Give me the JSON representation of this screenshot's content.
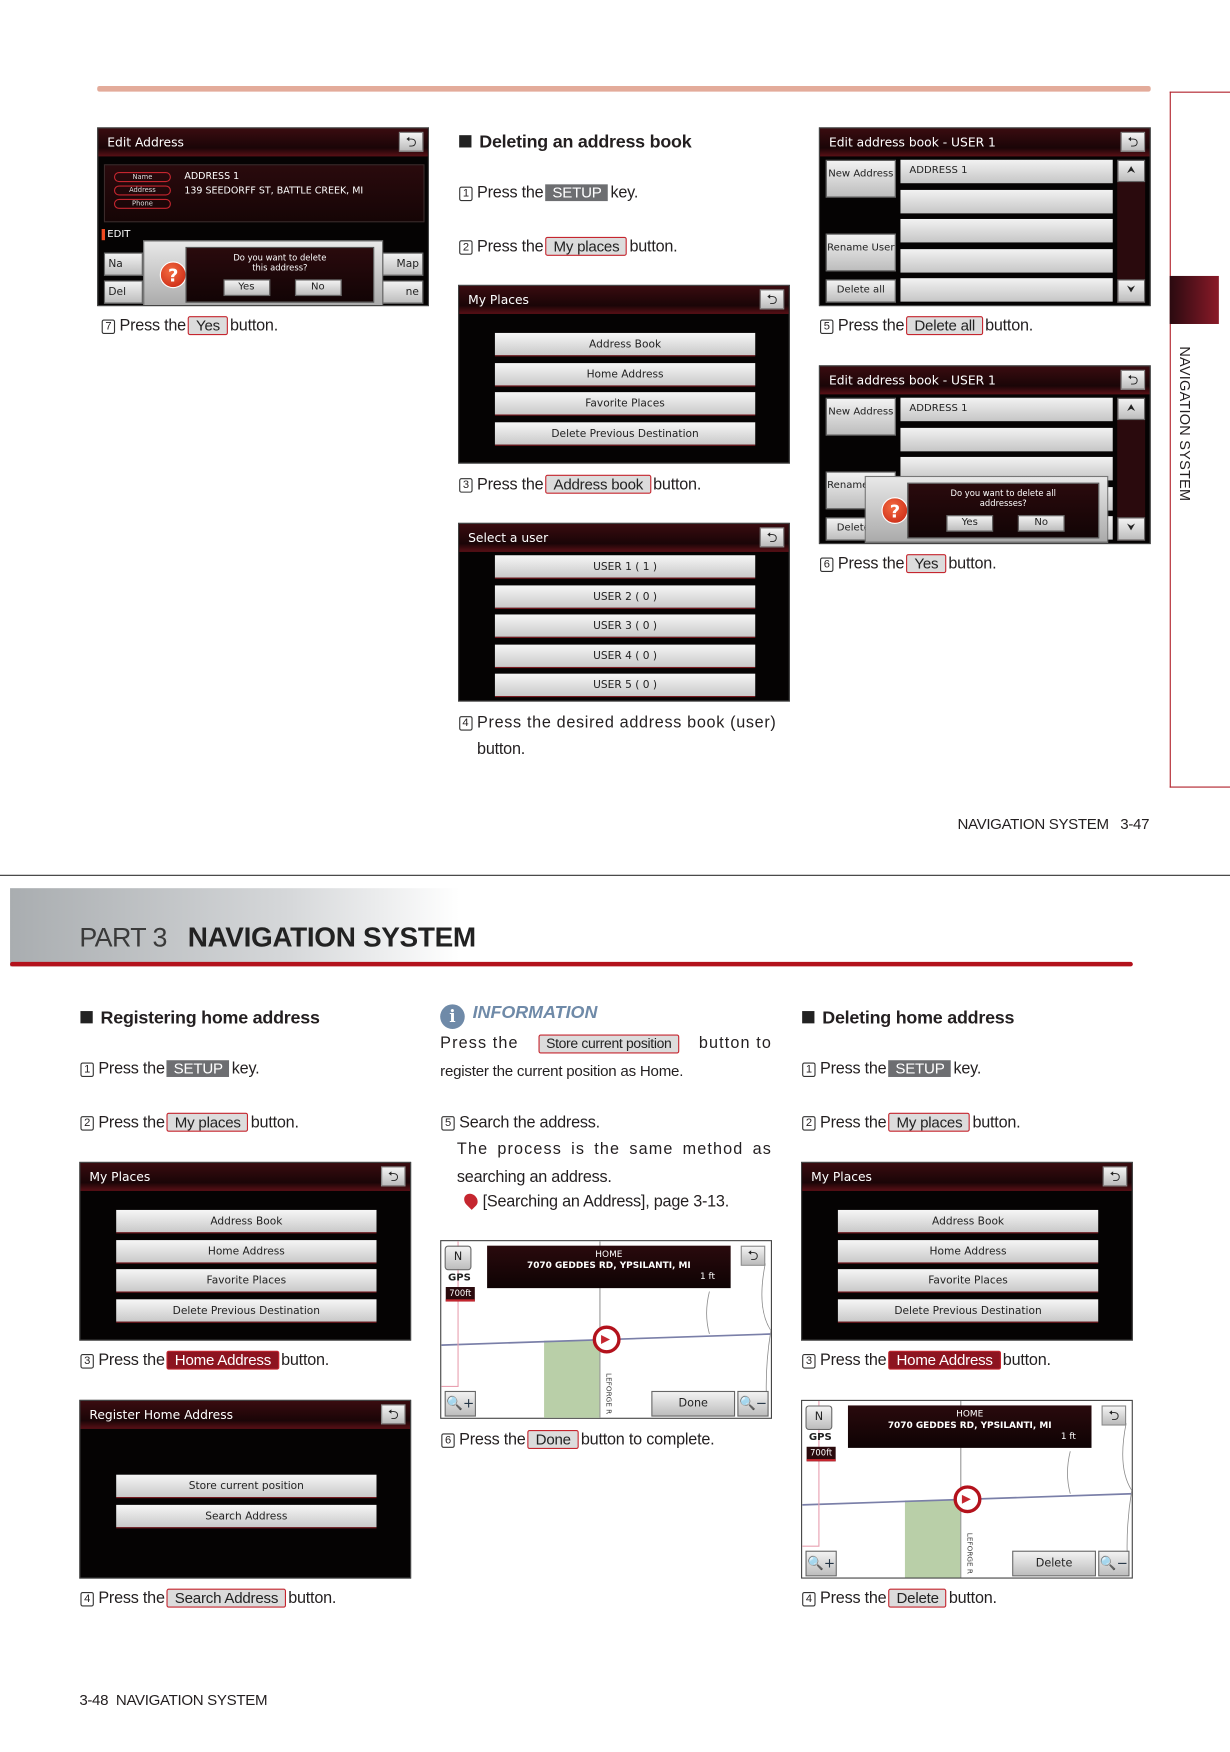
{
  "sidebar_label": "NAVIGATION SYSTEM",
  "top_page": {
    "footer": {
      "section": "NAVIGATION SYSTEM",
      "page": "3-47"
    },
    "col1": {
      "step7": {
        "num": "7",
        "pre": "Press the",
        "btn": "Yes",
        "post": "button."
      }
    },
    "col2": {
      "heading": "Deleting an address book",
      "step1": {
        "num": "1",
        "pre": "Press the",
        "btn": "SETUP",
        "post": "key."
      },
      "step2": {
        "num": "2",
        "pre": "Press the",
        "btn": "My places",
        "post": "button."
      },
      "step3": {
        "num": "3",
        "pre": "Press the",
        "btn": "Address book",
        "post": "button."
      },
      "step4": {
        "num": "4",
        "line1": "Press the desired address book (user)",
        "line2": "button."
      }
    },
    "col3": {
      "step5": {
        "num": "5",
        "pre": "Press the",
        "btn": "Delete all",
        "post": "button."
      },
      "step6": {
        "num": "6",
        "pre": "Press the",
        "btn": "Yes",
        "post": "button."
      }
    }
  },
  "bottom_page": {
    "banner": {
      "part": "PART 3",
      "title": "NAVIGATION SYSTEM"
    },
    "footer": {
      "page": "3-48",
      "section": "NAVIGATION SYSTEM"
    },
    "col1": {
      "heading": "Registering home address",
      "step1": {
        "num": "1",
        "pre": "Press the",
        "btn": "SETUP",
        "post": "key."
      },
      "step2": {
        "num": "2",
        "pre": "Press the",
        "btn": "My places",
        "post": "button."
      },
      "step3": {
        "num": "3",
        "pre": "Press the",
        "btn": "Home Address",
        "post": "button."
      },
      "step4": {
        "num": "4",
        "pre": "Press the",
        "btn": "Search Address",
        "post": "button."
      }
    },
    "col2": {
      "info_title": "INFORMATION",
      "info_pre": "Press the",
      "info_btn": "Store current position",
      "info_post": "button to",
      "info_line2": "register the current position as Home.",
      "step5": {
        "num": "5",
        "text": "Search the address.",
        "line2": "The process is the same method as",
        "line3": "searching an address.",
        "ref": "[Searching an Address], page 3-13."
      },
      "step6": {
        "num": "6",
        "pre": "Press the",
        "btn": "Done",
        "post": "button to complete."
      }
    },
    "col3": {
      "heading": "Deleting home address",
      "step1": {
        "num": "1",
        "pre": "Press the",
        "btn": "SETUP",
        "post": "key."
      },
      "step2": {
        "num": "2",
        "pre": "Press the",
        "btn": "My places",
        "post": "button."
      },
      "step3": {
        "num": "3",
        "pre": "Press the",
        "btn": "Home Address",
        "post": "button."
      },
      "step4": {
        "num": "4",
        "pre": "Press the",
        "btn": "Delete",
        "post": "button."
      }
    }
  },
  "screens": {
    "edit_address": {
      "title": "Edit Address",
      "fields": [
        "Name",
        "Address",
        "Phone"
      ],
      "values": [
        "ADDRESS 1",
        "139 SEEDORFF ST, BATTLE CREEK, MI",
        ""
      ],
      "edit": "EDIT",
      "partial_buttons": [
        "Na",
        "Map",
        "Del",
        "ne"
      ],
      "dialog": [
        "Do you want to delete",
        "this address?"
      ],
      "yes": "Yes",
      "no": "No"
    },
    "my_places": {
      "title": "My Places",
      "items": [
        "Address Book",
        "Home Address",
        "Favorite Places",
        "Delete Previous Destination"
      ]
    },
    "select_user": {
      "title": "Select a user",
      "items": [
        "USER 1 ( 1 )",
        "USER 2 ( 0 )",
        "USER 3 ( 0 )",
        "USER 4 ( 0 )",
        "USER 5 ( 0 )"
      ]
    },
    "address_book": {
      "title": "Edit address book - USER 1",
      "new": "New Address",
      "rename": "Rename User",
      "delete_all": "Delete all",
      "rows": [
        "ADDRESS 1",
        "",
        "",
        "",
        ""
      ],
      "dialog": [
        "Do you want to delete all",
        "addresses?"
      ],
      "yes": "Yes",
      "no": "No",
      "partial": [
        "Rena",
        "Use",
        "Delet"
      ]
    },
    "register_home": {
      "title": "Register Home Address",
      "items": [
        "Store current position",
        "Search Address"
      ]
    },
    "map": {
      "label": "HOME",
      "address": "7070 GEDDES RD, YPSILANTI, MI",
      "distance": "1 ft",
      "gps": "GPS",
      "scale": "700ft",
      "road": "LEFORGE R",
      "done": "Done",
      "delete": "Delete"
    }
  },
  "colors": {
    "accent_red": "#b3121c",
    "setup_key": "#6d6e71",
    "info_blue": "#6f8aa8"
  }
}
